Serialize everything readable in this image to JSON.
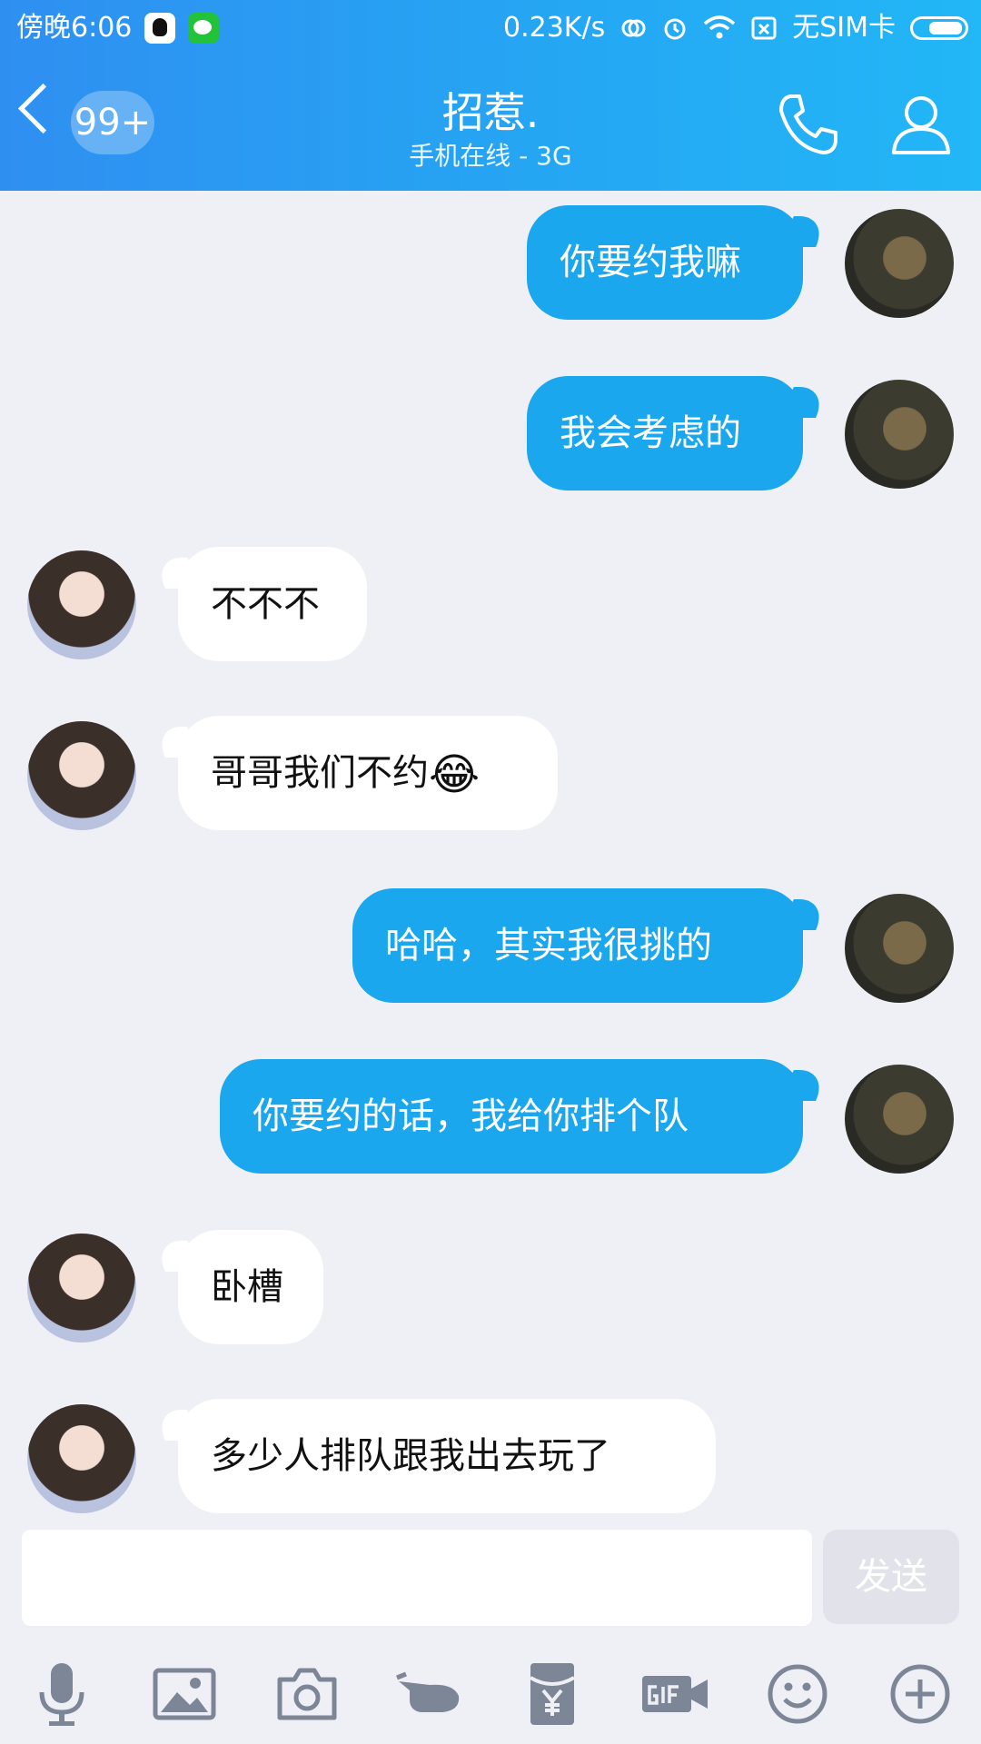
{
  "status_bar": {
    "time": "傍晚6:06",
    "network_speed": "0.23K/s",
    "sim_status": "无SIM卡",
    "icons": [
      "qq-icon",
      "wechat-icon",
      "sync-icon",
      "alarm-icon",
      "wifi-icon",
      "sim-icon",
      "battery-icon"
    ]
  },
  "header": {
    "unread_badge": "99+",
    "title": "招惹.",
    "subtitle": "手机在线 - 3G",
    "icons": [
      "back-chevron-icon",
      "phone-icon",
      "profile-icon"
    ]
  },
  "messages": [
    {
      "side": "out",
      "text": "你要约我嘛"
    },
    {
      "side": "out",
      "text": "我会考虑的"
    },
    {
      "side": "in",
      "text": "不不不"
    },
    {
      "side": "in",
      "text": "哥哥我们不约",
      "emoji": "😂"
    },
    {
      "side": "out",
      "text": "哈哈，其实我很挑的"
    },
    {
      "side": "out",
      "text": "你要约的话，我给你排个队"
    },
    {
      "side": "in",
      "text": "卧槽"
    },
    {
      "side": "in",
      "text": "多少人排队跟我出去玩了"
    }
  ],
  "composer": {
    "input_value": "",
    "send_label": "发送"
  },
  "toolbar": [
    "mic-icon",
    "image-icon",
    "camera-icon",
    "hand-poke-icon",
    "red-packet-icon",
    "gif-icon",
    "smiley-icon",
    "plus-icon"
  ],
  "colors": {
    "header_start": "#2f8ff1",
    "header_end": "#22b7f6",
    "bubble_out": "#1aa7ed",
    "bubble_in": "#ffffff",
    "background": "#eff0f6"
  }
}
